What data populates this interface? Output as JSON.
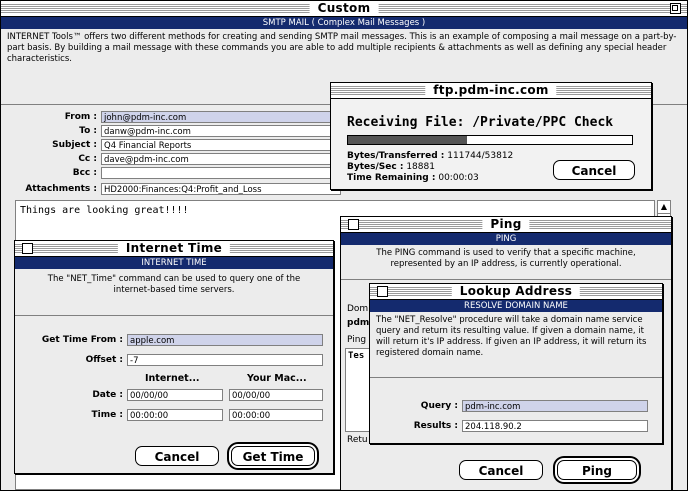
{
  "custom": {
    "title": "Custom",
    "subtitle": "SMTP MAIL ( Complex Mail Messages )",
    "description": "INTERNET Tools™ offers two different methods for creating and sending SMTP mail messages. This is an example of composing a mail message on a part-by-part basis. By building a mail message with these commands you are able to add multiple recipients & attachments as well as defining any special header characteristics.",
    "fields": [
      {
        "label": "From :",
        "value": "john@pdm-inc.com"
      },
      {
        "label": "To :",
        "value": "danw@pdm-inc.com"
      },
      {
        "label": "Subject :",
        "value": "Q4 Financial Reports"
      },
      {
        "label": "Cc :",
        "value": "dave@pdm-inc.com"
      },
      {
        "label": "Bcc :",
        "value": ""
      },
      {
        "label": "Attachments :",
        "value": "HD2000:Finances:Q4:Profit_and_Loss"
      }
    ],
    "body": "Things are looking great!!!!"
  },
  "ftp": {
    "title": "ftp.pdm-inc.com",
    "receiving": "Receiving File: /Private/PPC Check",
    "progress": 0.42,
    "bytes_transferred_label": "Bytes/Transferred :",
    "bytes_transferred": "111744/53812",
    "bytes_sec_label": "Bytes/Sec :",
    "bytes_sec": "18881",
    "time_remaining_label": "Time Remaining :",
    "time_remaining": "00:00:03",
    "cancel": "Cancel"
  },
  "ping": {
    "title": "Ping",
    "subtitle": "PING",
    "description": "The PING command is used to verify that a specific machine, represented by an IP address, is currently operational.",
    "dom_label": "Dom",
    "dom_value": "pdm",
    "ping_label": "Ping",
    "test_label": "Tes",
    "ret_label": "Retu",
    "cancel": "Cancel",
    "ping": "Ping"
  },
  "lookup": {
    "title": "Lookup Address",
    "subtitle": "RESOLVE DOMAIN NAME",
    "description": "The \"NET_Resolve\" procedure will take a domain name service query and return its resulting value.  If given a domain name, it will return it's IP address.  If given an IP address, it will return its registered domain name.",
    "query_label": "Query :",
    "query_value": "pdm-inc.com",
    "results_label": "Results :",
    "results_value": "204.118.90.2"
  },
  "itime": {
    "title": "Internet Time",
    "subtitle": "INTERNET TIME",
    "description": "The \"NET_Time\" command can be used to query one of the internet-based time servers.",
    "get_from_label": "Get Time From :",
    "get_from_value": "apple.com",
    "offset_label": "Offset :",
    "offset_value": "-7",
    "col_internet": "Internet...",
    "col_mac": "Your Mac...",
    "date_label": "Date :",
    "date_internet": "00/00/00",
    "date_mac": "00/00/00",
    "time_label": "Time :",
    "time_internet": "00:00:00",
    "time_mac": "00:00:00",
    "cancel": "Cancel",
    "get_time": "Get Time"
  }
}
